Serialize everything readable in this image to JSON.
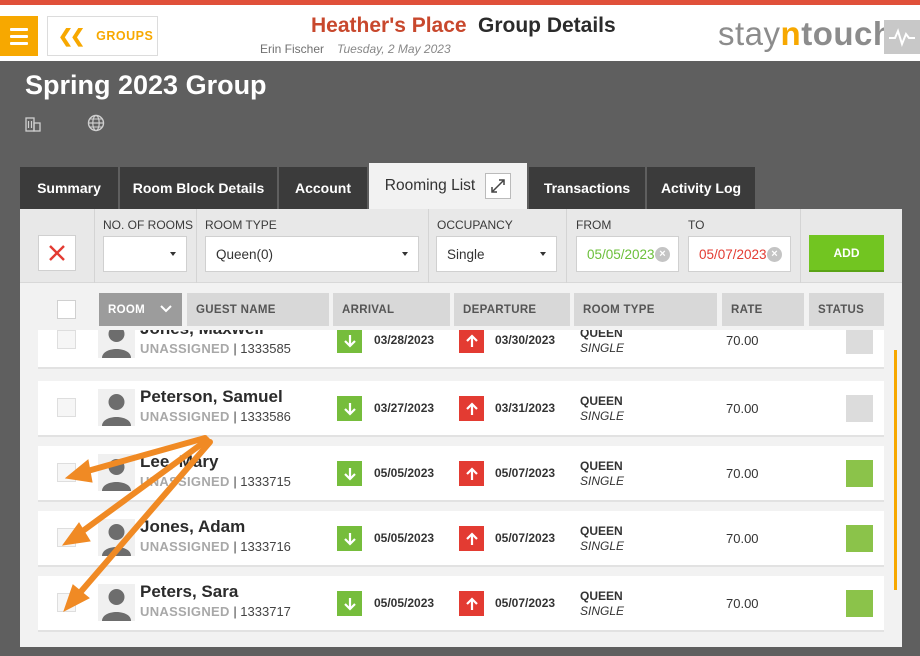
{
  "header": {
    "groups_label": "GROUPS",
    "hotel_name": "Heather's Place",
    "page_name": "Group Details",
    "user_name": "Erin Fischer",
    "business_date": "Tuesday, 2 May 2023",
    "logo_a": "stay",
    "logo_n": "n",
    "logo_b": "touch"
  },
  "group": {
    "title": "Spring 2023 Group"
  },
  "tabs": [
    {
      "label": "Summary"
    },
    {
      "label": "Room Block Details"
    },
    {
      "label": "Account"
    },
    {
      "label": "Rooming List"
    },
    {
      "label": "Transactions"
    },
    {
      "label": "Activity Log"
    }
  ],
  "filters": {
    "no_of_rooms_label": "NO. OF ROOMS",
    "no_of_rooms_value": "",
    "room_type_label": "ROOM TYPE",
    "room_type_value": "Queen(0)",
    "occupancy_label": "OCCUPANCY",
    "occupancy_value": "Single",
    "from_label": "FROM",
    "from_value": "05/05/2023",
    "to_label": "TO",
    "to_value": "05/07/2023",
    "add_label": "ADD",
    "from_color": "#6bbf3a",
    "to_color": "#e33b32"
  },
  "columns": {
    "room": "ROOM",
    "guest_name": "GUEST NAME",
    "arrival": "ARRIVAL",
    "departure": "DEPARTURE",
    "room_type": "ROOM TYPE",
    "rate": "RATE",
    "status": "STATUS"
  },
  "rows": [
    {
      "name": "Jones, Maxwell",
      "status_text": "UNASSIGNED",
      "conf": "| 1333585",
      "arrival": "03/28/2023",
      "departure": "03/30/2023",
      "type": "QUEEN",
      "occupancy": "SINGLE",
      "rate": "70.00",
      "status_color": "#dcdcdc"
    },
    {
      "name": "Peterson, Samuel",
      "status_text": "UNASSIGNED",
      "conf": "| 1333586",
      "arrival": "03/27/2023",
      "departure": "03/31/2023",
      "type": "QUEEN",
      "occupancy": "SINGLE",
      "rate": "70.00",
      "status_color": "#dcdcdc"
    },
    {
      "name": "Lee, Mary",
      "status_text": "UNASSIGNED",
      "conf": "| 1333715",
      "arrival": "05/05/2023",
      "departure": "05/07/2023",
      "type": "QUEEN",
      "occupancy": "SINGLE",
      "rate": "70.00",
      "status_color": "#8bc34a"
    },
    {
      "name": "Jones, Adam",
      "status_text": "UNASSIGNED",
      "conf": "| 1333716",
      "arrival": "05/05/2023",
      "departure": "05/07/2023",
      "type": "QUEEN",
      "occupancy": "SINGLE",
      "rate": "70.00",
      "status_color": "#8bc34a"
    },
    {
      "name": "Peters, Sara",
      "status_text": "UNASSIGNED",
      "conf": "| 1333717",
      "arrival": "05/05/2023",
      "departure": "05/07/2023",
      "type": "QUEEN",
      "occupancy": "SINGLE",
      "rate": "70.00",
      "status_color": "#8bc34a"
    }
  ],
  "colors": {
    "accent": "#f7a800",
    "brand_red": "#c8482d",
    "add_green": "#72c521",
    "annotation_arrow": "#f08a24"
  },
  "icons": [
    "menu-icon",
    "chevron-left-icon",
    "building-icon",
    "globe-icon",
    "expand-icon",
    "close-icon",
    "chevron-down-icon",
    "arrival-arrow-icon",
    "departure-arrow-icon",
    "avatar-icon",
    "clear-date-icon",
    "pulse-icon"
  ]
}
